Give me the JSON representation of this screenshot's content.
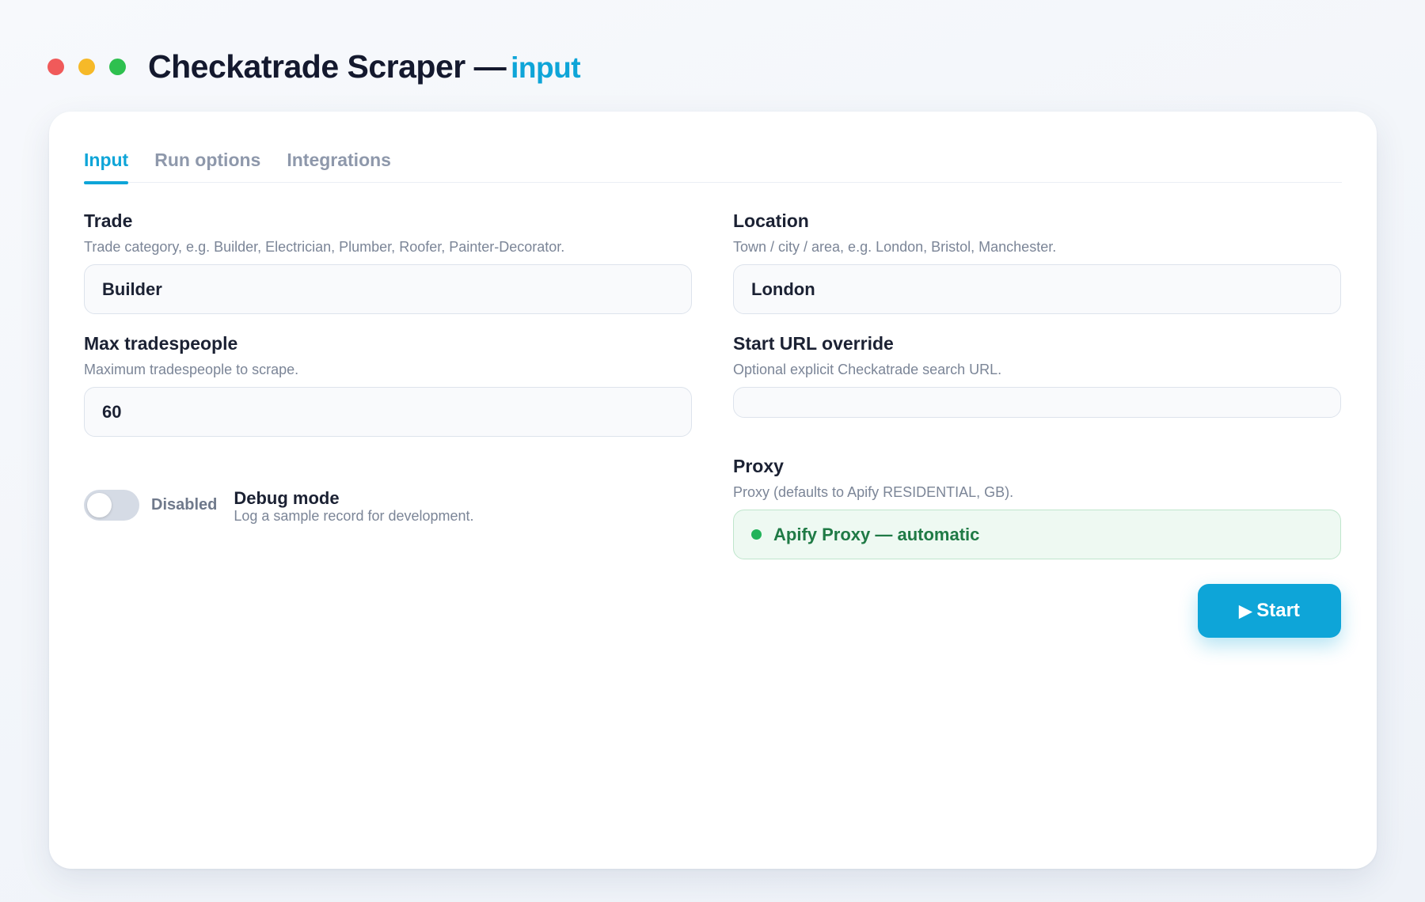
{
  "window": {
    "title": "Checkatrade Scraper —",
    "title_accent": "input",
    "controls": [
      {
        "name": "close",
        "color": "#f05a5a"
      },
      {
        "name": "minimize",
        "color": "#f6b928"
      },
      {
        "name": "maximize",
        "color": "#2ec04f"
      }
    ]
  },
  "tabs": [
    {
      "label": "Input",
      "active": true
    },
    {
      "label": "Run options",
      "active": false
    },
    {
      "label": "Integrations",
      "active": false
    }
  ],
  "fields": {
    "trade": {
      "label": "Trade",
      "help": "Trade category, e.g. Builder, Electrician, Plumber, Roofer, Painter-Decorator.",
      "value": "Builder"
    },
    "location": {
      "label": "Location",
      "help": "Town / city / area, e.g. London, Bristol, Manchester.",
      "value": "London"
    },
    "max_tradespeople": {
      "label": "Max tradespeople",
      "help": "Maximum tradespeople to scrape.",
      "value": "60"
    },
    "start_url": {
      "label": "Start URL override",
      "help": "Optional explicit Checkatrade search URL.",
      "value": ""
    },
    "proxy": {
      "label": "Proxy",
      "help": "Proxy (defaults to Apify RESIDENTIAL, GB).",
      "value": "Apify Proxy — automatic"
    }
  },
  "debug": {
    "state_label": "Disabled",
    "enabled": false,
    "title": "Debug mode",
    "help": "Log a sample record for development."
  },
  "actions": {
    "start_icon": "play-icon",
    "start_glyph": "▶",
    "start_label": "Start"
  },
  "colors": {
    "accent": "#0ea5d8",
    "proxy_ok": "#22b35a"
  }
}
